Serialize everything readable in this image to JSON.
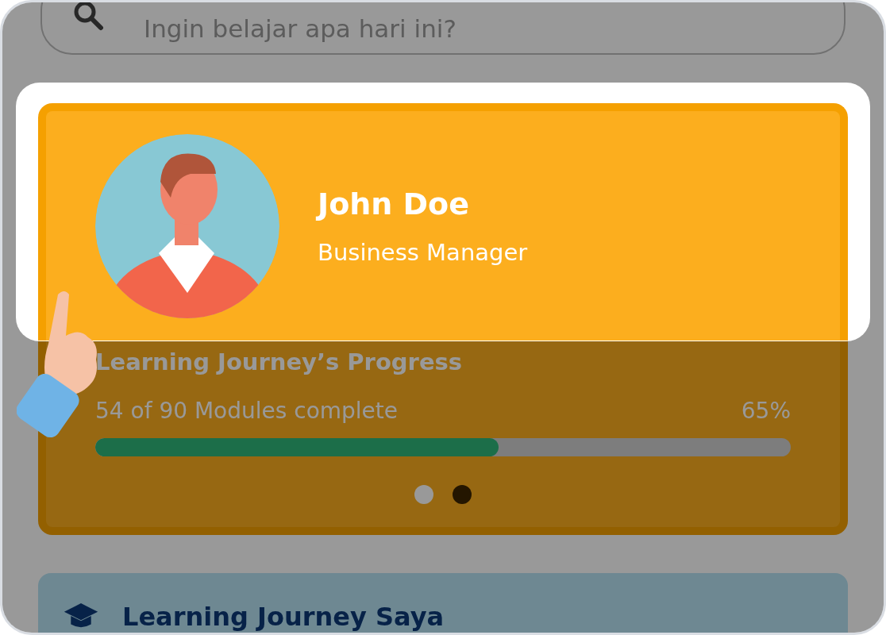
{
  "search": {
    "placeholder": "Ingin belajar apa hari ini?"
  },
  "profile": {
    "name": "John Doe",
    "role": "Business Manager"
  },
  "progress": {
    "title": "Learning Journey’s Progress",
    "summary": "54 of 90 Modules complete",
    "percent": "65%",
    "level": 0.58
  },
  "pager": [
    {
      "selected": true
    },
    {
      "selected": false
    }
  ],
  "journey_card": {
    "title": "Learning Journey Saya"
  }
}
